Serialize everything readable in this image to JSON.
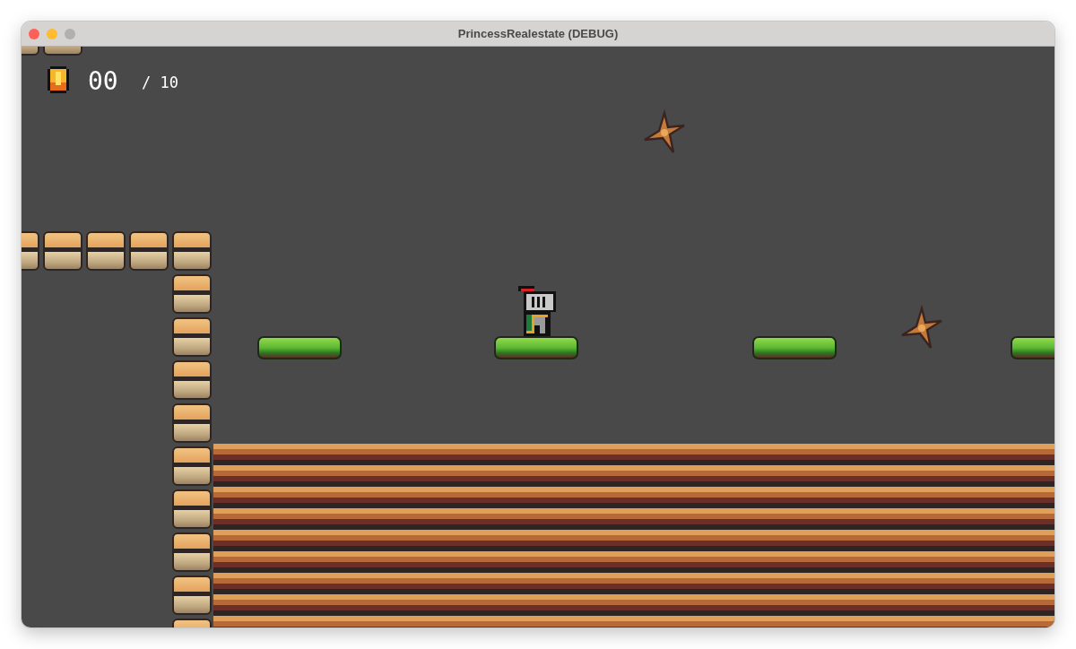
{
  "window": {
    "title": "PrincessRealestate (DEBUG)"
  },
  "hud": {
    "coins": "00",
    "total": "/ 10"
  }
}
